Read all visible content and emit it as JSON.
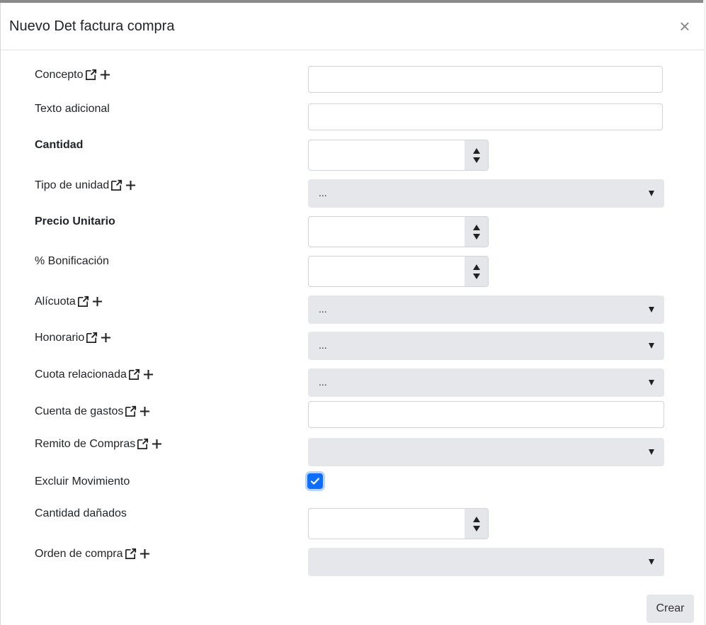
{
  "modal": {
    "title": "Nuevo Det factura compra",
    "close_symbol": "×"
  },
  "fields": {
    "concepto": {
      "label": "Concepto",
      "value": ""
    },
    "texto_adicional": {
      "label": "Texto adicional",
      "value": ""
    },
    "cantidad": {
      "label": "Cantidad",
      "value": ""
    },
    "tipo_unidad": {
      "label": "Tipo de unidad",
      "selected": "..."
    },
    "precio_unitario": {
      "label": "Precio Unitario",
      "value": ""
    },
    "bonificacion": {
      "label": "% Bonificación",
      "value": ""
    },
    "alicuota": {
      "label": "Alícuota",
      "selected": "..."
    },
    "honorario": {
      "label": "Honorario",
      "selected": "..."
    },
    "cuota_relacionada": {
      "label": "Cuota relacionada",
      "selected": "..."
    },
    "cuenta_gastos": {
      "label": "Cuenta de gastos",
      "value": ""
    },
    "remito_compras": {
      "label": "Remito de Compras",
      "selected": ""
    },
    "excluir_movimiento": {
      "label": "Excluir Movimiento",
      "checked": true
    },
    "cantidad_danados": {
      "label": "Cantidad dañados",
      "value": ""
    },
    "orden_compra": {
      "label": "Orden de compra",
      "selected": ""
    }
  },
  "footer": {
    "submit_label": "Crear"
  },
  "colors": {
    "accent": "#0d6efd",
    "select_bg": "#e5e7eb",
    "border": "#ced4da"
  },
  "icons": [
    "external-link-icon",
    "plus-icon",
    "checkmark-icon",
    "close-icon",
    "chevron-down-icon",
    "spinner-up-icon",
    "spinner-down-icon"
  ]
}
